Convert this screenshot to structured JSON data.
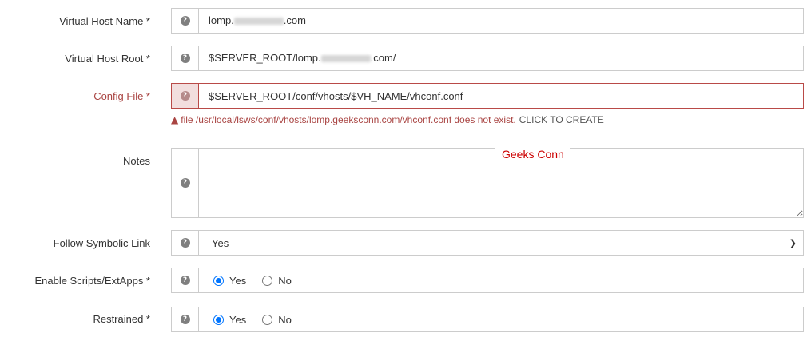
{
  "fields": {
    "virtual_host_name": {
      "label": "Virtual Host Name *",
      "value_prefix": "lomp.",
      "value_suffix": ".com"
    },
    "virtual_host_root": {
      "label": "Virtual Host Root *",
      "value_prefix": "$SERVER_ROOT/lomp.",
      "value_suffix": ".com/"
    },
    "config_file": {
      "label": "Config File *",
      "value": "$SERVER_ROOT/conf/vhosts/$VH_NAME/vhconf.conf",
      "error_text": "file /usr/local/lsws/conf/vhosts/lomp.geeksconn.com/vhconf.conf does not exist.",
      "error_action": "CLICK TO CREATE"
    },
    "notes": {
      "label": "Notes",
      "value": ""
    },
    "follow_symbolic_link": {
      "label": "Follow Symbolic Link",
      "selected": "Yes"
    },
    "enable_scripts": {
      "label": "Enable Scripts/ExtApps *",
      "yes": "Yes",
      "no": "No",
      "selected": "Yes"
    },
    "restrained": {
      "label": "Restrained *",
      "yes": "Yes",
      "no": "No",
      "selected": "Yes"
    }
  },
  "watermark": "Geeks Conn",
  "icons": {
    "help": "question-circle-icon",
    "warning": "warning-triangle-icon",
    "select": "chevron-down-icon"
  },
  "colors": {
    "error": "#a94442",
    "radio_accent": "#0075ff"
  }
}
